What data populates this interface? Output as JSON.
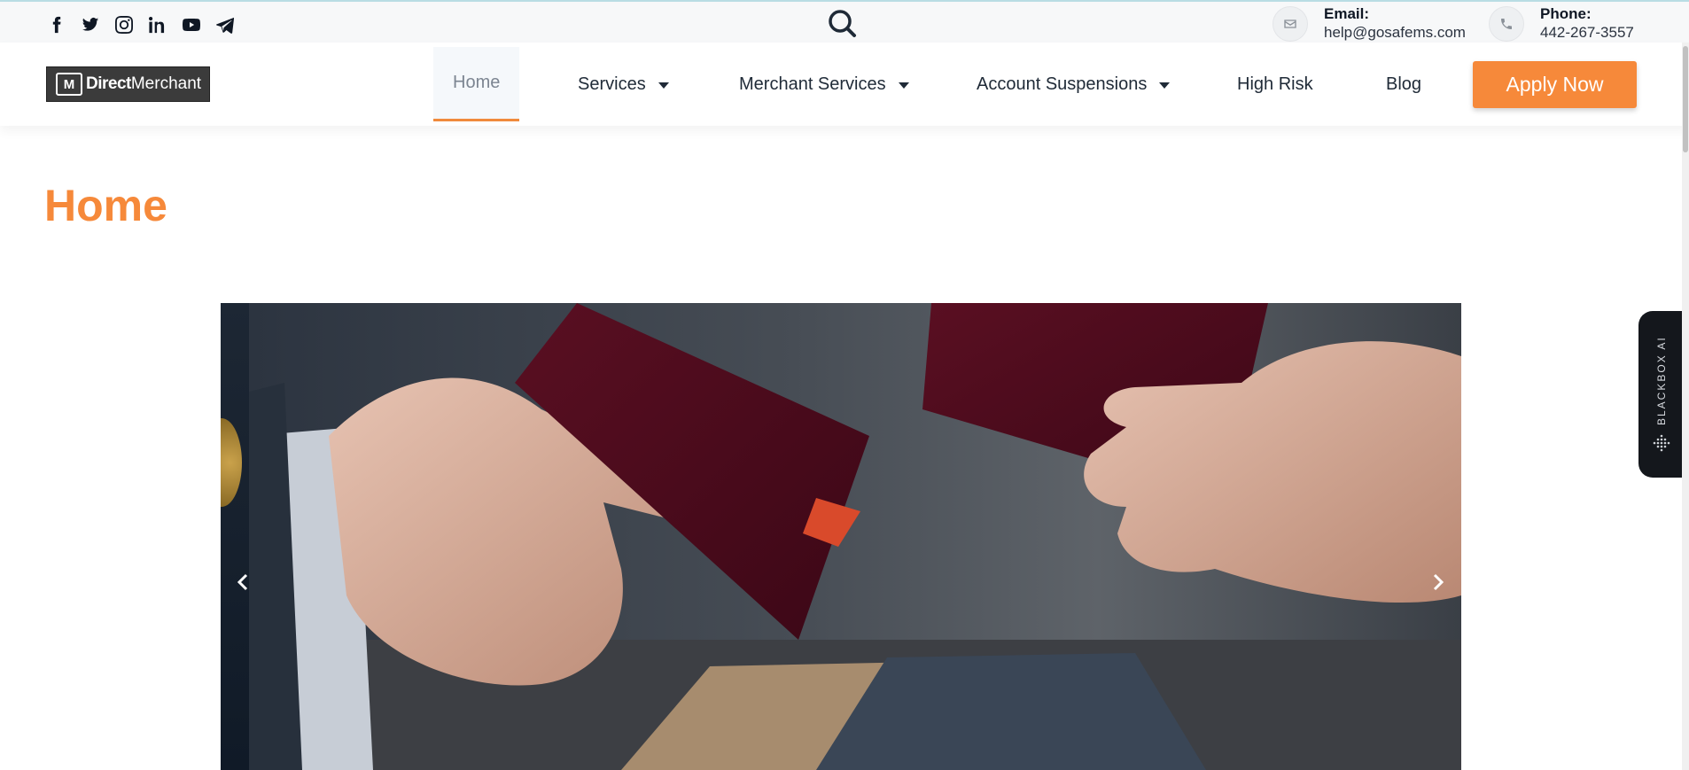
{
  "topbar": {
    "social_icons": [
      "facebook-icon",
      "twitter-icon",
      "instagram-icon",
      "linkedin-icon",
      "youtube-icon",
      "telegram-icon"
    ],
    "email": {
      "label": "Email:",
      "value": "help@gosafems.com"
    },
    "phone": {
      "label": "Phone:",
      "value": "442-267-3557"
    }
  },
  "brand": {
    "logo_text_bold": "Direct",
    "logo_text_light": "Merchant"
  },
  "nav": {
    "home": "Home",
    "services": "Services",
    "merchant_services": "Merchant Services",
    "account_suspensions": "Account Suspensions",
    "high_risk": "High Risk",
    "blog": "Blog",
    "apply": "Apply Now"
  },
  "page": {
    "title": "Home"
  },
  "side_widget": {
    "label": "BLACKBOX AI"
  },
  "colors": {
    "accent": "#f6893a",
    "dark": "#1f2a37",
    "topbar_bg": "#f7f8f9"
  }
}
